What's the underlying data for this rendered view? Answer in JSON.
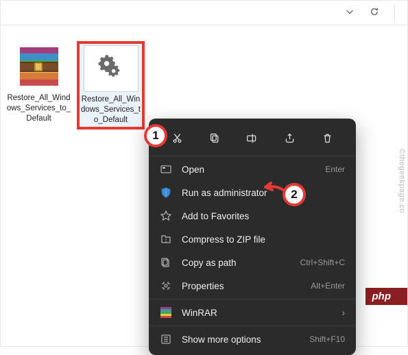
{
  "toolbar": {
    "dropdown_icon": "chevron-down",
    "refresh_icon": "refresh"
  },
  "files": {
    "archive": {
      "label": "Restore_All_Windows_Services_to_Default"
    },
    "batch": {
      "label": "Restore_All_Windows_Services_to_Default"
    }
  },
  "callouts": {
    "one": "1",
    "two": "2"
  },
  "context_menu": {
    "top_actions": {
      "cut": "cut",
      "copy": "copy",
      "rename": "rename",
      "share": "share",
      "delete": "delete"
    },
    "items": {
      "open": {
        "label": "Open",
        "accel": "Enter"
      },
      "admin": {
        "label": "Run as administrator",
        "accel": ""
      },
      "favorites": {
        "label": "Add to Favorites",
        "accel": ""
      },
      "zip": {
        "label": "Compress to ZIP file",
        "accel": ""
      },
      "copypath": {
        "label": "Copy as path",
        "accel": "Ctrl+Shift+C"
      },
      "properties": {
        "label": "Properties",
        "accel": "Alt+Enter"
      },
      "winrar": {
        "label": "WinRAR",
        "accel": ""
      },
      "more": {
        "label": "Show more options",
        "accel": "Shift+F10"
      }
    }
  },
  "watermark": "©thegeekpage.co",
  "badge": "php"
}
